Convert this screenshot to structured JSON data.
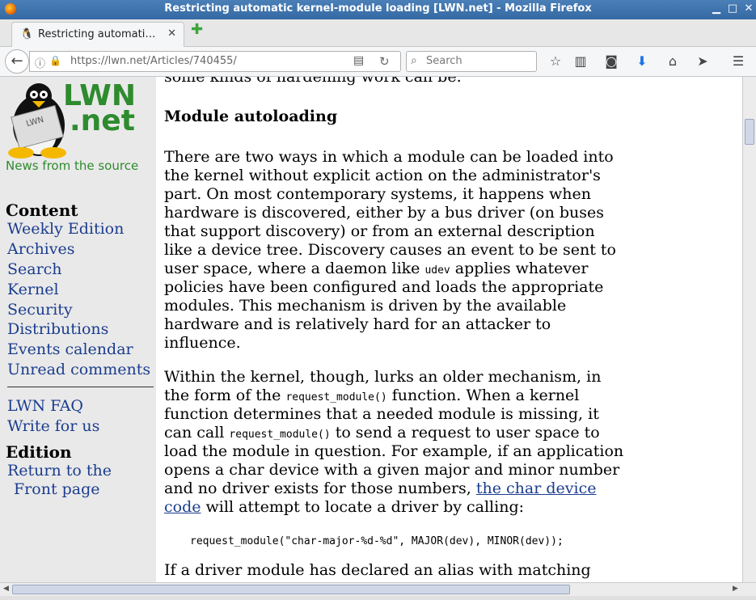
{
  "window": {
    "title": "Restricting automatic kernel-module loading [LWN.net] - Mozilla Firefox",
    "minimize": "▁",
    "maximize": "□",
    "close": "✕"
  },
  "tab": {
    "label": "Restricting automati…",
    "close": "✕",
    "new_tab": "✚"
  },
  "navbar": {
    "back": "←",
    "url": "https://lwn.net/Articles/740455/",
    "search_placeholder": "Search",
    "icons": [
      "star-icon",
      "reading-list-icon",
      "pocket-icon",
      "download-icon",
      "home-icon",
      "send-icon",
      "menu-icon"
    ]
  },
  "logo": {
    "text1": "LWN",
    "text2": ".net",
    "tagline": "News from the source"
  },
  "sidebar": {
    "content_heading": "Content",
    "content_links": [
      "Weekly Edition",
      "Archives",
      "Search",
      "Kernel",
      "Security",
      "Distributions",
      "Events calendar",
      "Unread comments"
    ],
    "extra_links": [
      "LWN FAQ",
      "Write for us"
    ],
    "edition_heading": "Edition",
    "edition_link_1": "Return to the",
    "edition_link_2": "Front page"
  },
  "article": {
    "top_line": "some kinds of hardening work can be.",
    "heading": "Module autoloading",
    "p1": [
      "There are two ways in which a module can be loaded into",
      "the kernel without explicit action on the administrator's",
      "part. On most contemporary systems, it happens when",
      "hardware is discovered, either by a bus driver (on buses",
      "that support discovery) or from an external description",
      "like a device tree. Discovery causes an event to be sent to"
    ],
    "p1_l7_a": "user space, where a daemon like ",
    "p1_l7_code": "udev",
    "p1_l7_b": " applies whatever",
    "p1_rest": [
      "policies have been configured and loads the appropriate",
      "modules. This mechanism is driven by the available",
      "hardware and is relatively hard for an attacker to",
      "influence."
    ],
    "p2_l1": "Within the kernel, though, lurks an older mechanism, in",
    "p2_l2_a": "the form of the ",
    "p2_l2_code": "request_module()",
    "p2_l2_b": " function. When a kernel",
    "p2_l3": "function determines that a needed module is missing, it",
    "p2_l4_a": "can call ",
    "p2_l4_code": "request_module()",
    "p2_l4_b": " to send a request to user space to",
    "p2_l5": "load the module in question. For example, if an application",
    "p2_l6": "opens a char device with a given major and minor number",
    "p2_l7_a": "and no driver exists for those numbers, ",
    "p2_l7_link": "the char device",
    "p2_l8_link": "code",
    "p2_l8_b": " will attempt to locate a driver by calling:",
    "code": "request_module(\"char-major-%d-%d\", MAJOR(dev), MINOR(dev));",
    "p3_l1": "If a driver module has declared an alias with matching"
  }
}
